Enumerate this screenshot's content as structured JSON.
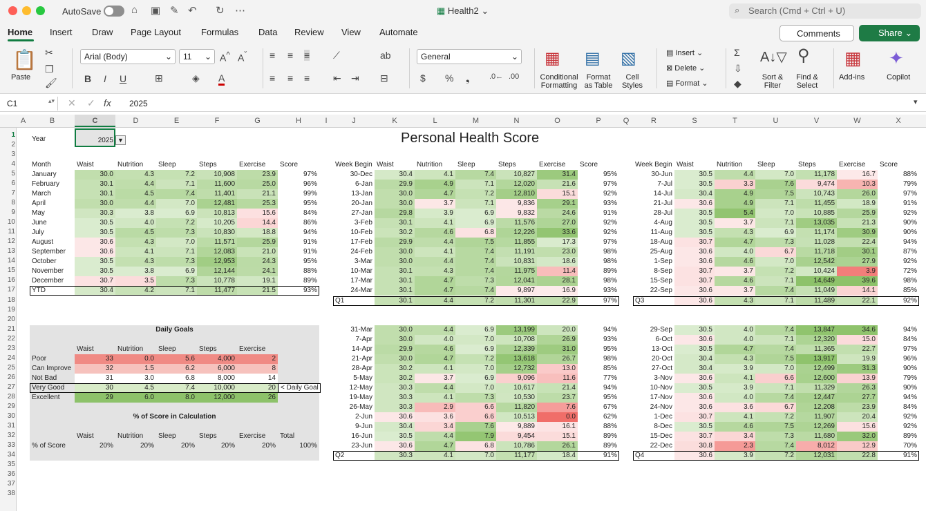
{
  "app": {
    "autosave_label": "AutoSave",
    "doc_title": "Health2",
    "search_placeholder": "Search (Cmd + Ctrl + U)"
  },
  "tabs": [
    "Home",
    "Insert",
    "Draw",
    "Page Layout",
    "Formulas",
    "Data",
    "Review",
    "View",
    "Automate"
  ],
  "buttons": {
    "comments": "Comments",
    "share": "Share"
  },
  "ribbon": {
    "paste": "Paste",
    "font_name": "Arial (Body)",
    "font_size": "11",
    "number_format": "General",
    "conditional_formatting": "Conditional\nFormatting",
    "format_as_table": "Format\nas Table",
    "cell_styles": "Cell\nStyles",
    "insert": "Insert",
    "delete": "Delete",
    "format": "Format",
    "sort_filter": "Sort &\nFilter",
    "find_select": "Find &\nSelect",
    "addins": "Add-ins",
    "copilot": "Copilot"
  },
  "formula_bar": {
    "name_box": "C1",
    "fx": "fx",
    "value": "2025"
  },
  "columns": [
    "A",
    "B",
    "C",
    "D",
    "E",
    "F",
    "G",
    "H",
    "I",
    "J",
    "K",
    "L",
    "M",
    "N",
    "O",
    "P",
    "Q",
    "R",
    "S",
    "T",
    "U",
    "V",
    "W",
    "X"
  ],
  "rows": [
    "1",
    "2",
    "3",
    "4",
    "5",
    "6",
    "7",
    "8",
    "9",
    "10",
    "11",
    "12",
    "13",
    "14",
    "15",
    "16",
    "17",
    "18",
    "19",
    "20",
    "21",
    "22",
    "23",
    "24",
    "25",
    "26",
    "27",
    "28",
    "29",
    "30",
    "31",
    "32",
    "33",
    "34",
    "35",
    "36",
    "37",
    "38"
  ],
  "sheet": {
    "title": "Personal Health Score",
    "year_label": "Year",
    "year_value": "2025",
    "headers": [
      "Waist",
      "Nutrition",
      "Sleep",
      "Steps",
      "Exercise",
      "Score"
    ],
    "month_header": "Month",
    "week_header": "Week Begin",
    "months": [
      [
        "January",
        "30.0",
        "4.3",
        "7.2",
        "10,908",
        "23.9",
        "97%"
      ],
      [
        "February",
        "30.1",
        "4.4",
        "7.1",
        "11,600",
        "25.0",
        "96%"
      ],
      [
        "March",
        "30.1",
        "4.5",
        "7.4",
        "11,401",
        "21.1",
        "99%"
      ],
      [
        "April",
        "30.0",
        "4.4",
        "7.0",
        "12,481",
        "25.3",
        "95%"
      ],
      [
        "May",
        "30.3",
        "3.8",
        "6.9",
        "10,813",
        "15.6",
        "84%"
      ],
      [
        "June",
        "30.5",
        "4.0",
        "7.2",
        "10,205",
        "14.4",
        "86%"
      ],
      [
        "July",
        "30.5",
        "4.5",
        "7.3",
        "10,830",
        "18.8",
        "94%"
      ],
      [
        "August",
        "30.6",
        "4.3",
        "7.0",
        "11,571",
        "25.9",
        "91%"
      ],
      [
        "September",
        "30.6",
        "4.1",
        "7.1",
        "12,083",
        "21.0",
        "91%"
      ],
      [
        "October",
        "30.5",
        "4.3",
        "7.3",
        "12,953",
        "24.3",
        "95%"
      ],
      [
        "November",
        "30.5",
        "3.8",
        "6.9",
        "12,144",
        "24.1",
        "88%"
      ],
      [
        "December",
        "30.7",
        "3.5",
        "7.3",
        "10,778",
        "19.1",
        "89%"
      ],
      [
        "YTD",
        "30.4",
        "4.2",
        "7.1",
        "11,477",
        "21.5",
        "93%"
      ]
    ],
    "q1": [
      [
        "30-Dec",
        "30.4",
        "4.1",
        "7.4",
        "10,827",
        "31.4",
        "95%"
      ],
      [
        "6-Jan",
        "29.9",
        "4.9",
        "7.1",
        "12,020",
        "21.6",
        "97%"
      ],
      [
        "13-Jan",
        "30.0",
        "4.7",
        "7.2",
        "12,810",
        "15.1",
        "92%"
      ],
      [
        "20-Jan",
        "30.0",
        "3.7",
        "7.1",
        "9,836",
        "29.1",
        "93%"
      ],
      [
        "27-Jan",
        "29.8",
        "3.9",
        "6.9",
        "9,832",
        "24.6",
        "91%"
      ],
      [
        "3-Feb",
        "30.1",
        "4.1",
        "6.9",
        "11,576",
        "27.0",
        "92%"
      ],
      [
        "10-Feb",
        "30.2",
        "4.6",
        "6.8",
        "12,226",
        "33.6",
        "92%"
      ],
      [
        "17-Feb",
        "29.9",
        "4.4",
        "7.5",
        "11,855",
        "17.3",
        "97%"
      ],
      [
        "24-Feb",
        "30.0",
        "4.1",
        "7.4",
        "11,191",
        "23.0",
        "98%"
      ],
      [
        "3-Mar",
        "30.0",
        "4.4",
        "7.4",
        "10,831",
        "18.6",
        "98%"
      ],
      [
        "10-Mar",
        "30.1",
        "4.3",
        "7.4",
        "11,975",
        "11.4",
        "89%"
      ],
      [
        "17-Mar",
        "30.1",
        "4.7",
        "7.3",
        "12,041",
        "28.1",
        "98%"
      ],
      [
        "24-Mar",
        "30.1",
        "4.7",
        "7.4",
        "9,897",
        "16.9",
        "93%"
      ],
      [
        "Q1",
        "30.1",
        "4.4",
        "7.2",
        "11,301",
        "22.9",
        "97%"
      ]
    ],
    "q3": [
      [
        "30-Jun",
        "30.5",
        "4.4",
        "7.0",
        "11,178",
        "16.7",
        "88%"
      ],
      [
        "7-Jul",
        "30.5",
        "3.3",
        "7.6",
        "9,474",
        "10.3",
        "79%"
      ],
      [
        "14-Jul",
        "30.4",
        "4.9",
        "7.5",
        "10,743",
        "26.0",
        "97%"
      ],
      [
        "21-Jul",
        "30.6",
        "4.9",
        "7.1",
        "11,455",
        "18.9",
        "91%"
      ],
      [
        "28-Jul",
        "30.5",
        "5.4",
        "7.0",
        "10,885",
        "25.9",
        "92%"
      ],
      [
        "4-Aug",
        "30.5",
        "3.7",
        "7.1",
        "13,035",
        "21.3",
        "90%"
      ],
      [
        "11-Aug",
        "30.5",
        "4.3",
        "6.9",
        "11,174",
        "30.9",
        "90%"
      ],
      [
        "18-Aug",
        "30.7",
        "4.7",
        "7.3",
        "11,028",
        "22.4",
        "94%"
      ],
      [
        "25-Aug",
        "30.6",
        "4.0",
        "6.7",
        "11,718",
        "30.1",
        "87%"
      ],
      [
        "1-Sep",
        "30.6",
        "4.6",
        "7.0",
        "12,542",
        "27.9",
        "92%"
      ],
      [
        "8-Sep",
        "30.7",
        "3.7",
        "7.2",
        "10,424",
        "3.9",
        "72%"
      ],
      [
        "15-Sep",
        "30.7",
        "4.6",
        "7.1",
        "14,649",
        "39.6",
        "98%"
      ],
      [
        "22-Sep",
        "30.6",
        "3.7",
        "7.4",
        "11,049",
        "14.1",
        "85%"
      ],
      [
        "Q3",
        "30.6",
        "4.3",
        "7.1",
        "11,489",
        "22.1",
        "92%"
      ]
    ],
    "q2": [
      [
        "31-Mar",
        "30.0",
        "4.4",
        "6.9",
        "13,199",
        "20.0",
        "94%"
      ],
      [
        "7-Apr",
        "30.0",
        "4.0",
        "7.0",
        "10,708",
        "26.9",
        "93%"
      ],
      [
        "14-Apr",
        "29.9",
        "4.6",
        "6.9",
        "12,339",
        "31.0",
        "95%"
      ],
      [
        "21-Apr",
        "30.0",
        "4.7",
        "7.2",
        "13,618",
        "26.7",
        "98%"
      ],
      [
        "28-Apr",
        "30.2",
        "4.1",
        "7.0",
        "12,732",
        "13.0",
        "85%"
      ],
      [
        "5-May",
        "30.2",
        "3.7",
        "6.9",
        "9,096",
        "11.6",
        "77%"
      ],
      [
        "12-May",
        "30.3",
        "4.4",
        "7.0",
        "10,617",
        "21.4",
        "94%"
      ],
      [
        "19-May",
        "30.3",
        "4.1",
        "7.3",
        "10,530",
        "23.7",
        "95%"
      ],
      [
        "26-May",
        "30.3",
        "2.9",
        "6.6",
        "11,820",
        "7.6",
        "67%"
      ],
      [
        "2-Jun",
        "30.6",
        "3.6",
        "6.6",
        "10,513",
        "0.0",
        "62%"
      ],
      [
        "9-Jun",
        "30.4",
        "3.4",
        "7.6",
        "9,889",
        "16.1",
        "88%"
      ],
      [
        "16-Jun",
        "30.5",
        "4.4",
        "7.9",
        "9,454",
        "15.1",
        "89%"
      ],
      [
        "23-Jun",
        "30.6",
        "4.7",
        "6.8",
        "10,786",
        "26.1",
        "89%"
      ],
      [
        "Q2",
        "30.3",
        "4.1",
        "7.0",
        "11,177",
        "18.4",
        "91%"
      ]
    ],
    "q4": [
      [
        "29-Sep",
        "30.5",
        "4.0",
        "7.4",
        "13,847",
        "34.6",
        "94%"
      ],
      [
        "6-Oct",
        "30.6",
        "4.0",
        "7.1",
        "12,320",
        "15.0",
        "84%"
      ],
      [
        "13-Oct",
        "30.5",
        "4.7",
        "7.4",
        "11,365",
        "22.7",
        "97%"
      ],
      [
        "20-Oct",
        "30.4",
        "4.3",
        "7.5",
        "13,917",
        "19.9",
        "96%"
      ],
      [
        "27-Oct",
        "30.4",
        "3.9",
        "7.0",
        "12,499",
        "31.3",
        "90%"
      ],
      [
        "3-Nov",
        "30.6",
        "4.1",
        "6.6",
        "12,600",
        "13.9",
        "79%"
      ],
      [
        "10-Nov",
        "30.5",
        "3.9",
        "7.1",
        "11,329",
        "26.3",
        "90%"
      ],
      [
        "17-Nov",
        "30.6",
        "4.0",
        "7.4",
        "12,447",
        "27.7",
        "94%"
      ],
      [
        "24-Nov",
        "30.6",
        "3.6",
        "6.7",
        "12,208",
        "23.9",
        "84%"
      ],
      [
        "1-Dec",
        "30.7",
        "4.1",
        "7.2",
        "11,907",
        "20.4",
        "92%"
      ],
      [
        "8-Dec",
        "30.5",
        "4.6",
        "7.5",
        "12,269",
        "15.6",
        "92%"
      ],
      [
        "15-Dec",
        "30.7",
        "3.4",
        "7.3",
        "11,680",
        "32.0",
        "89%"
      ],
      [
        "22-Dec",
        "30.8",
        "2.3",
        "7.4",
        "8,012",
        "12.9",
        "70%"
      ],
      [
        "Q4",
        "30.6",
        "3.9",
        "7.2",
        "12,031",
        "22.8",
        "91%"
      ]
    ],
    "goals_title": "Daily Goals",
    "goals_headers": [
      "Waist",
      "Nutrition",
      "Sleep",
      "Steps",
      "Exercise"
    ],
    "goals": [
      [
        "Poor",
        "33",
        "0.0",
        "5.6",
        "4,000",
        "2"
      ],
      [
        "Can Improve",
        "32",
        "1.5",
        "6.2",
        "6,000",
        "8"
      ],
      [
        "Not Bad",
        "31",
        "3.0",
        "6.8",
        "8,000",
        "14"
      ],
      [
        "Very Good",
        "30",
        "4.5",
        "7.4",
        "10,000",
        "20"
      ],
      [
        "Excellent",
        "29",
        "6.0",
        "8.0",
        "12,000",
        "26"
      ]
    ],
    "daily_goal_note": "< Daily Goal",
    "pct_title": "% of Score in Calculation",
    "pct_headers": [
      "Waist",
      "Nutrition",
      "Sleep",
      "Steps",
      "Exercise",
      "Total"
    ],
    "pct_row": [
      "% of Score",
      "20%",
      "20%",
      "20%",
      "20%",
      "20%",
      "100%"
    ]
  },
  "colors": {
    "excel_green": "#107c41",
    "share_green": "#1e7b45",
    "goals_panel": "#e3e3e3",
    "poor": "#f08a84",
    "can_improve": "#f6c2bd",
    "very_good": "#d8ebc8",
    "excellent": "#8dc26a",
    "accent_red": "#e05555"
  }
}
